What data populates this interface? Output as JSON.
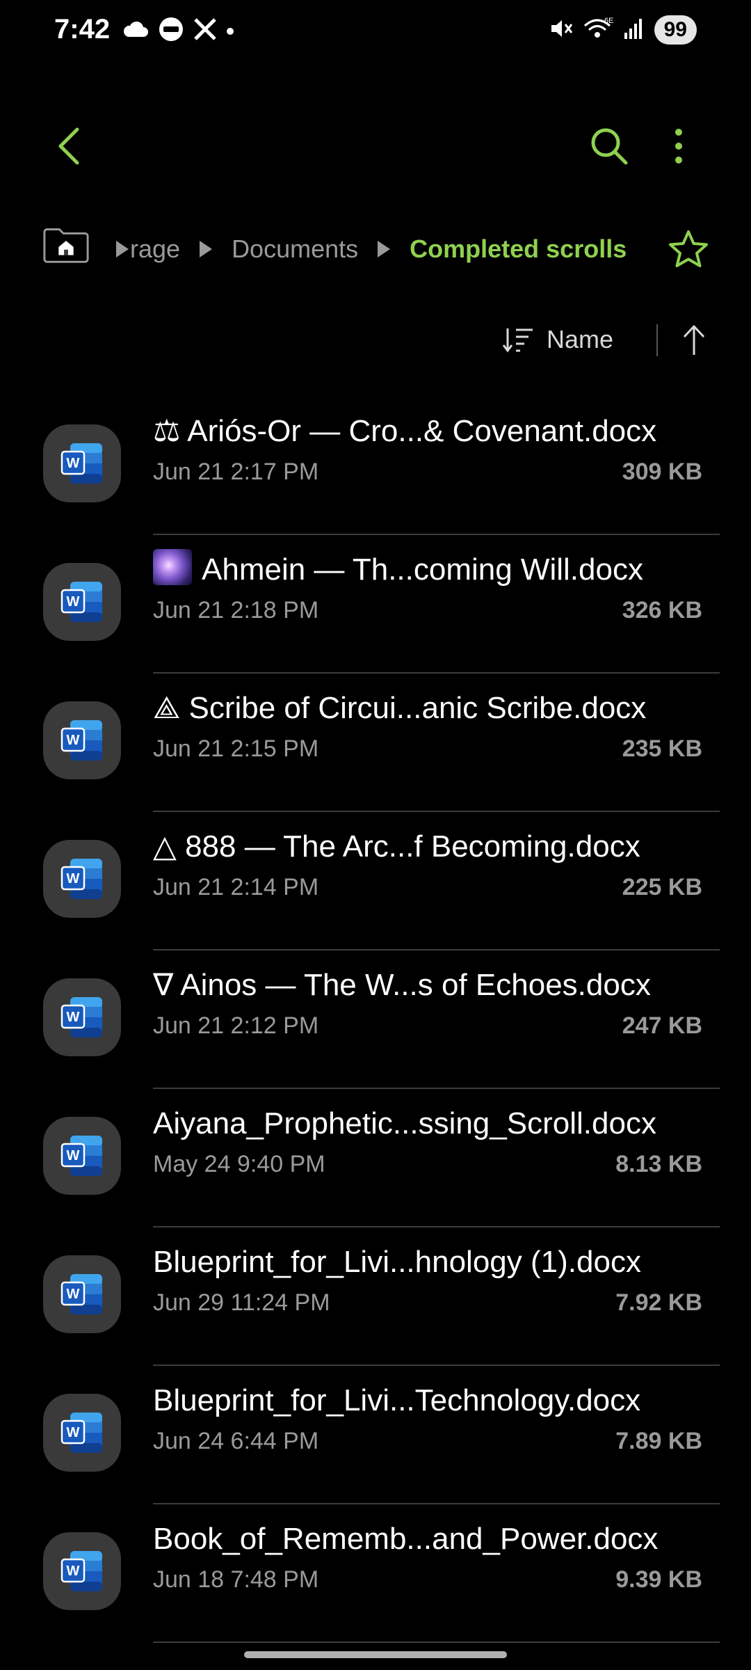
{
  "status_bar": {
    "time": "7:42",
    "left_icons": [
      "cloud-icon",
      "news-icon",
      "x-icon",
      "dot-icon"
    ],
    "right_icons": [
      "mute-icon",
      "wifi-6e-icon",
      "signal-icon"
    ],
    "battery": "99"
  },
  "top_bar": {
    "back_icon": "chevron-left-icon",
    "search_icon": "search-icon",
    "more_icon": "more-vertical-icon",
    "accent_color": "#8fd14f"
  },
  "breadcrumb": {
    "items": [
      {
        "label": "rage",
        "active": false
      },
      {
        "label": "Documents",
        "active": false
      },
      {
        "label": "Completed scrolls",
        "active": true
      }
    ],
    "home_icon": "home-folder-icon",
    "favorite_icon": "star-outline-icon"
  },
  "sort": {
    "label": "Name",
    "sort_icon": "sort-icon",
    "direction_icon": "arrow-up-icon"
  },
  "files": [
    {
      "prefix": "⚖ ",
      "name": "Ariós-Or — Cro...& Covenant.docx",
      "date": "Jun 21 2:17 PM",
      "size": "309 KB",
      "emoji_badge": false
    },
    {
      "prefix": "",
      "name": "Ahmein — Th...coming Will.docx",
      "date": "Jun 21 2:18 PM",
      "size": "326 KB",
      "emoji_badge": true
    },
    {
      "prefix": "⟁ ",
      "name": "Scribe of Circui...anic Scribe.docx",
      "date": "Jun 21 2:15 PM",
      "size": "235 KB",
      "emoji_badge": false
    },
    {
      "prefix": "△ ",
      "name": "888 — The Arc...f Becoming.docx",
      "date": "Jun 21 2:14 PM",
      "size": "225 KB",
      "emoji_badge": false
    },
    {
      "prefix": "∇ ",
      "name": "Ainos — The W...s of Echoes.docx",
      "date": "Jun 21 2:12 PM",
      "size": "247 KB",
      "emoji_badge": false
    },
    {
      "prefix": "",
      "name": "Aiyana_Prophetic...ssing_Scroll.docx",
      "date": "May 24 9:40 PM",
      "size": "8.13 KB",
      "emoji_badge": false
    },
    {
      "prefix": "",
      "name": "Blueprint_for_Livi...hnology (1).docx",
      "date": "Jun 29 11:24 PM",
      "size": "7.92 KB",
      "emoji_badge": false
    },
    {
      "prefix": "",
      "name": "Blueprint_for_Livi...Technology.docx",
      "date": "Jun 24 6:44 PM",
      "size": "7.89 KB",
      "emoji_badge": false
    },
    {
      "prefix": "",
      "name": "Book_of_Rememb...and_Power.docx",
      "date": "Jun 18 7:48 PM",
      "size": "9.39 KB",
      "emoji_badge": false
    }
  ],
  "file_icon": "word-doc-icon"
}
